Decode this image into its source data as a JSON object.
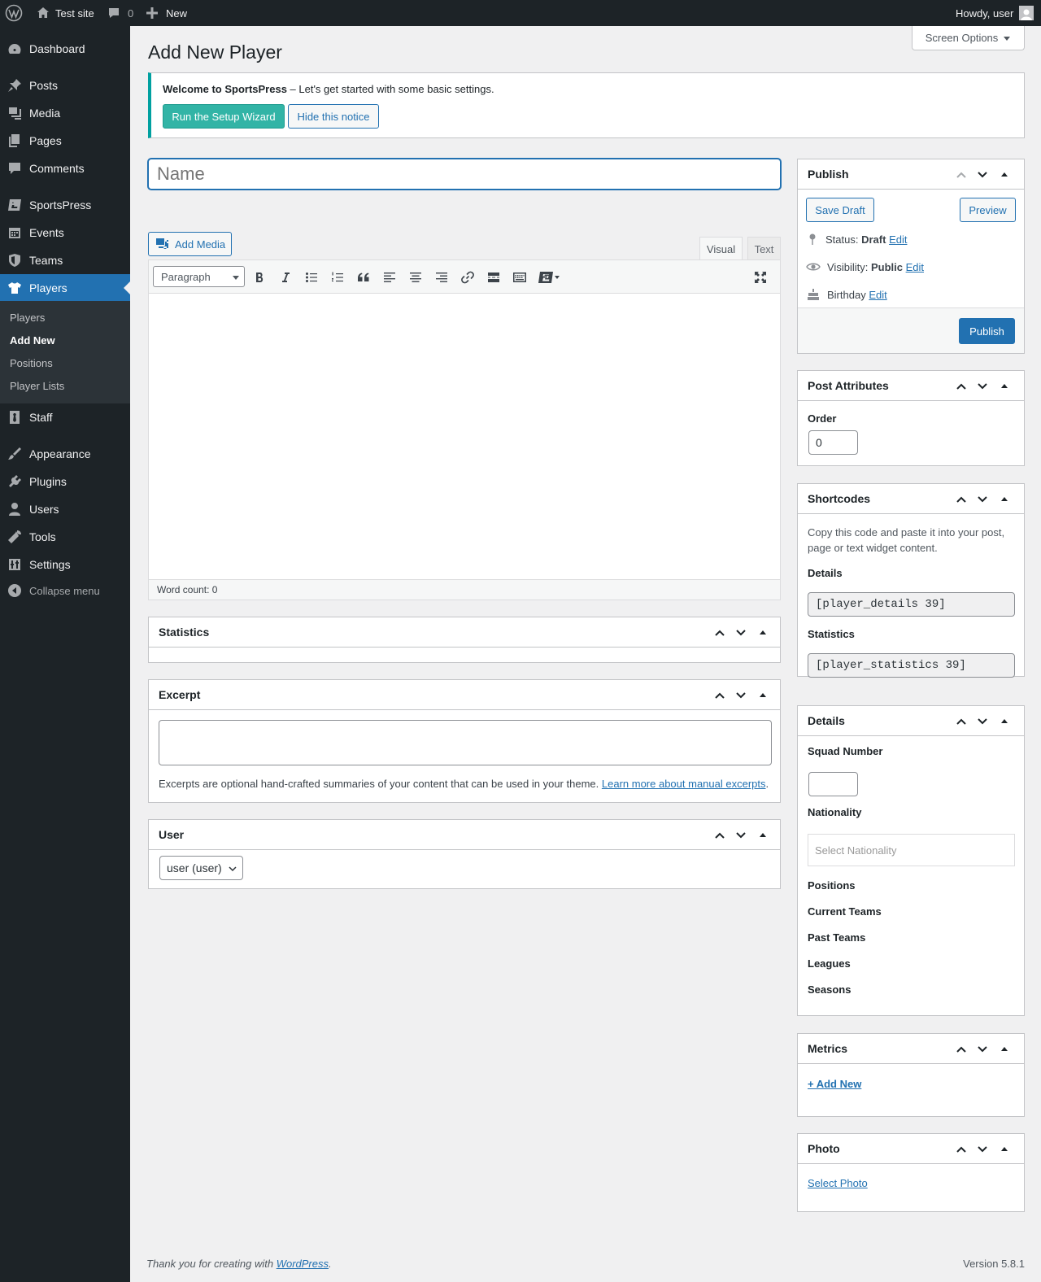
{
  "adminbar": {
    "site_name": "Test site",
    "comments_count": "0",
    "new_label": "New",
    "howdy": "Howdy, user"
  },
  "sidebar": {
    "items": [
      {
        "label": "Dashboard",
        "icon": "dashboard-icon"
      },
      {
        "label": "Posts",
        "icon": "pin-icon"
      },
      {
        "label": "Media",
        "icon": "media-icon"
      },
      {
        "label": "Pages",
        "icon": "pages-icon"
      },
      {
        "label": "Comments",
        "icon": "comment-icon"
      },
      {
        "label": "SportsPress",
        "icon": "sportspress-icon"
      },
      {
        "label": "Events",
        "icon": "calendar-icon"
      },
      {
        "label": "Teams",
        "icon": "shield-icon"
      },
      {
        "label": "Players",
        "icon": "shirt-icon"
      },
      {
        "label": "Staff",
        "icon": "tie-icon"
      },
      {
        "label": "Appearance",
        "icon": "brush-icon"
      },
      {
        "label": "Plugins",
        "icon": "plugin-icon"
      },
      {
        "label": "Users",
        "icon": "user-icon"
      },
      {
        "label": "Tools",
        "icon": "wrench-icon"
      },
      {
        "label": "Settings",
        "icon": "settings-icon"
      }
    ],
    "submenu": [
      "Players",
      "Add New",
      "Positions",
      "Player Lists"
    ],
    "collapse": "Collapse menu"
  },
  "screen_options": "Screen Options",
  "page_title": "Add New Player",
  "notice": {
    "bold": "Welcome to SportsPress",
    "text": " – Let's get started with some basic settings.",
    "wizard_button": "Run the Setup Wizard",
    "hide_button": "Hide this notice"
  },
  "title_placeholder": "Name",
  "editor": {
    "add_media": "Add Media",
    "tab_visual": "Visual",
    "tab_text": "Text",
    "format": "Paragraph",
    "word_count": "Word count: 0"
  },
  "boxes": {
    "statistics": "Statistics",
    "excerpt": "Excerpt",
    "excerpt_help": "Excerpts are optional hand-crafted summaries of your content that can be used in your theme.",
    "excerpt_link": "Learn more about manual excerpts",
    "user": "User",
    "user_value": "user (user)"
  },
  "publish": {
    "title": "Publish",
    "save_draft": "Save Draft",
    "preview": "Preview",
    "status_label": "Status:",
    "status_value": "Draft",
    "visibility_label": "Visibility:",
    "visibility_value": "Public",
    "birthday_label": "Birthday",
    "edit": "Edit",
    "publish_button": "Publish"
  },
  "attributes": {
    "title": "Post Attributes",
    "order_label": "Order",
    "order_value": "0"
  },
  "shortcodes": {
    "title": "Shortcodes",
    "help": "Copy this code and paste it into your post, page or text widget content.",
    "details_label": "Details",
    "details_code": "[player_details 39]",
    "statistics_label": "Statistics",
    "statistics_code": "[player_statistics 39]"
  },
  "details": {
    "title": "Details",
    "squad_number": "Squad Number",
    "nationality": "Nationality",
    "nationality_placeholder": "Select Nationality",
    "positions": "Positions",
    "current_teams": "Current Teams",
    "past_teams": "Past Teams",
    "leagues": "Leagues",
    "seasons": "Seasons"
  },
  "metrics": {
    "title": "Metrics",
    "add_new": "+ Add New"
  },
  "photo": {
    "title": "Photo",
    "select": "Select Photo"
  },
  "footer": {
    "thanks": "Thank you for creating with ",
    "wp_link": "WordPress",
    "period": ".",
    "version": "Version 5.8.1"
  }
}
